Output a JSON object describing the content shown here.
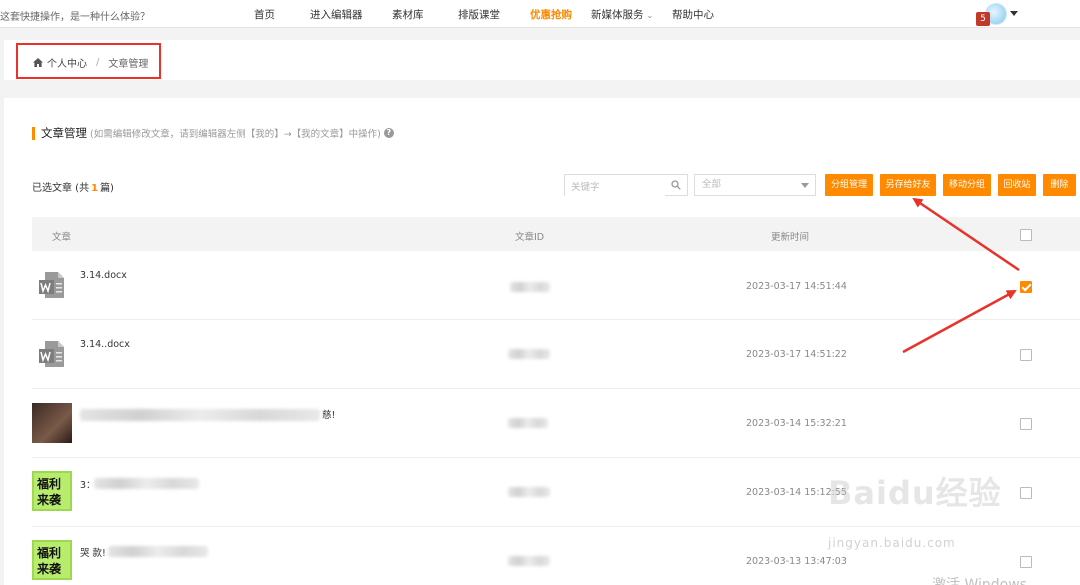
{
  "topnav": {
    "promo": "这套快捷操作，是一种什么体验？",
    "items": [
      {
        "label": "首页"
      },
      {
        "label": "进入编辑器"
      },
      {
        "label": "素材库"
      },
      {
        "label": "排版课堂"
      },
      {
        "label": "优惠抢购"
      },
      {
        "label": "新媒体服务"
      },
      {
        "label": "帮助中心"
      }
    ],
    "badge_count": "5",
    "highlight_color": "#ff8a00"
  },
  "breadcrumb": {
    "home": "个人中心",
    "separator": "/",
    "current": "文章管理"
  },
  "section": {
    "title": "文章管理",
    "hint": "(如需编辑修改文章，请到编辑器左侧【我的】→【我的文章】中操作)",
    "help_icon": "?"
  },
  "selection": {
    "prefix": "已选文章 (共",
    "count": "1",
    "suffix": "篇)"
  },
  "search": {
    "placeholder": "关键字"
  },
  "filter": {
    "selected": "全部"
  },
  "toolbar": {
    "group_manage": "分组管理",
    "save_to_friend": "另存给好友",
    "move_group": "移动分组",
    "recycle_bin": "回收站",
    "delete": "删除"
  },
  "table": {
    "headers": {
      "article": "文章",
      "id": "文章ID",
      "updated": "更新时间"
    },
    "rows": [
      {
        "title": "3.14.docx",
        "time": "2023-03-17 14:51:44",
        "checked": true
      },
      {
        "title": "3.14..docx",
        "time": "2023-03-17 14:51:22",
        "checked": false
      },
      {
        "title": "慈!",
        "time": "2023-03-14 15:32:21",
        "checked": false
      },
      {
        "title": "3：",
        "time": "2023-03-14 15:12:55",
        "checked": false
      },
      {
        "title": "哭 款!",
        "time": "2023-03-13 13:47:03",
        "checked": false
      }
    ]
  },
  "thumbnails": {
    "fuli_line1": "福利",
    "fuli_line2": "来袭"
  },
  "watermark": {
    "brand": "Baidu经验",
    "url": "jingyan.baidu.com",
    "activate": "激活 Windows"
  }
}
